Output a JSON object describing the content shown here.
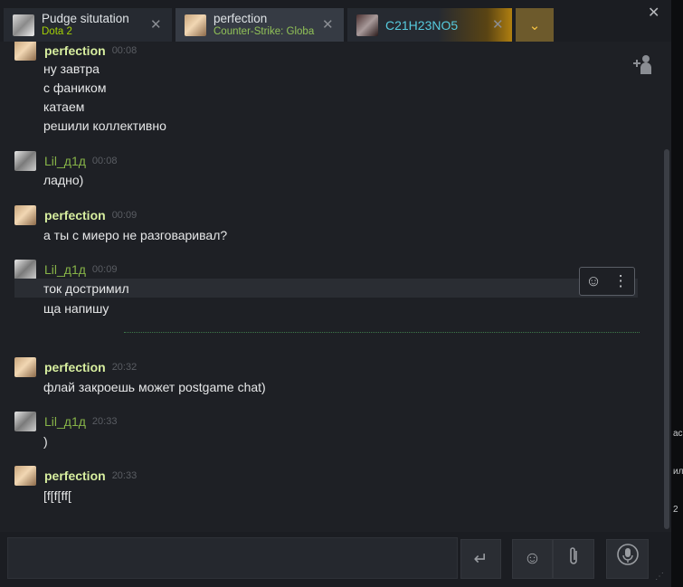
{
  "tabs": [
    {
      "name": "Pudge situtation",
      "status": "Dota 2"
    },
    {
      "name": "perfection",
      "status": "Counter-Strike: Global Offensive"
    },
    {
      "name": "C21H23NO5",
      "status": ""
    }
  ],
  "messages": [
    {
      "author": "perfection",
      "time": "00:08",
      "lines": [
        "ну завтра",
        "с фаником",
        "катаем",
        "решили коллективно"
      ]
    },
    {
      "author": "Lil_д1д",
      "time": "00:08",
      "lines": [
        "ладно)"
      ]
    },
    {
      "author": "perfection",
      "time": "00:09",
      "lines": [
        "а ты с миеро не разговаривал?"
      ]
    },
    {
      "author": "Lil_д1д",
      "time": "00:09",
      "lines": [
        "ток достримил",
        "ща напишу"
      ]
    },
    {
      "author": "perfection",
      "time": "20:32",
      "lines": [
        "флай закроешь может postgame chat)"
      ]
    },
    {
      "author": "Lil_д1д",
      "time": "20:33",
      "lines": [
        ")"
      ]
    },
    {
      "author": "perfection",
      "time": "20:33",
      "lines": [
        "[f[f[ff["
      ]
    }
  ],
  "input": {
    "value": "",
    "placeholder": ""
  },
  "edge_text": [
    "ас",
    "ил",
    "2"
  ],
  "colors": {
    "accent_gold": "#f5c342",
    "online_green": "#91c257",
    "ingame_green": "#a3cf06",
    "name_blue": "#57cbde"
  },
  "icons": {
    "close": "close-icon",
    "dropdown": "chevron-down-icon",
    "add_friend": "add-user-icon",
    "emoji": "emoji-icon",
    "attach": "paperclip-icon",
    "voice": "microphone-icon",
    "send": "enter-icon",
    "more": "more-vertical-icon"
  }
}
